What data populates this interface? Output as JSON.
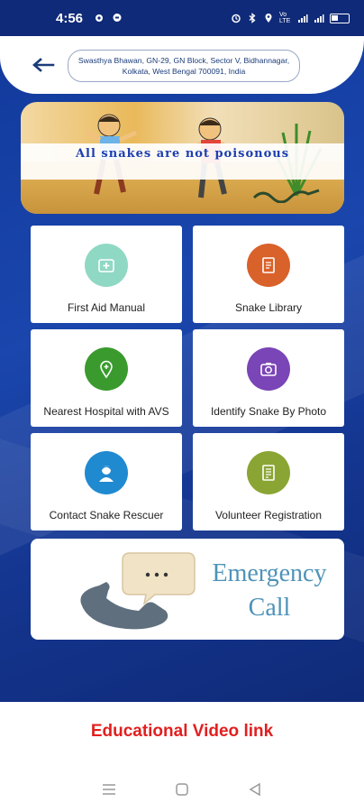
{
  "status_bar": {
    "time": "4:56",
    "signal_text": "Vo LTE"
  },
  "header": {
    "address": "Swasthya Bhawan, GN-29, GN Block, Sector V, Bidhannagar, Kolkata, West Bengal 700091, India"
  },
  "banner": {
    "text": "All snakes are not poisonous"
  },
  "menu": {
    "items": [
      {
        "label": "First Aid Manual",
        "icon": "first-aid-icon",
        "color": "#8fd8c4"
      },
      {
        "label": "Snake Library",
        "icon": "library-icon",
        "color": "#d9612a"
      },
      {
        "label": "Nearest Hospital with AVS",
        "icon": "hospital-location-icon",
        "color": "#3a9a2e"
      },
      {
        "label": "Identify Snake By Photo",
        "icon": "camera-icon",
        "color": "#7a45b6"
      },
      {
        "label": "Contact Snake Rescuer",
        "icon": "rescuer-icon",
        "color": "#1f8ad0"
      },
      {
        "label": "Volunteer Registration",
        "icon": "registration-icon",
        "color": "#8aa534"
      }
    ]
  },
  "emergency": {
    "line1": "Emergency",
    "line2": "Call"
  },
  "footer": {
    "video_link": "Educational Video link"
  },
  "colors": {
    "primary_blue": "#123a9c",
    "link_red": "#e21f1f",
    "emergency_text": "#4e93b8"
  }
}
